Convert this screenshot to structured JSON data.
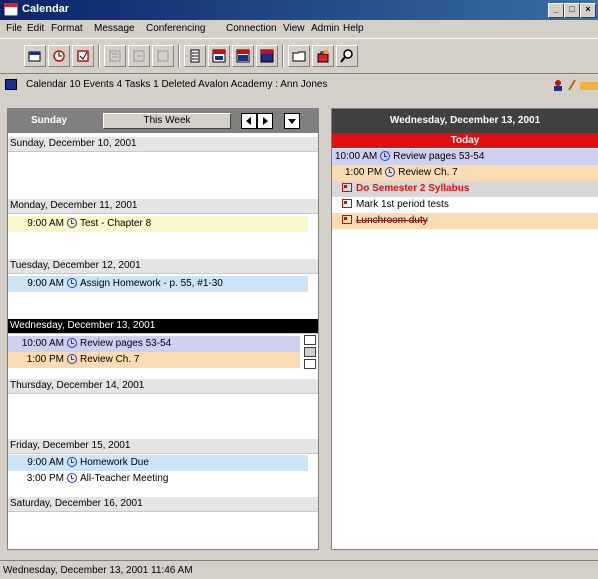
{
  "window": {
    "title": "Calendar"
  },
  "menu": [
    "File",
    "Edit",
    "Format",
    "Message",
    "Conferencing",
    "Connection",
    "View",
    "Admin",
    "Help"
  ],
  "toolbar": {
    "icons": [
      "new-window-icon",
      "open-icon",
      "open-alt-icon",
      "disabled-icon-1",
      "disabled-icon-2",
      "disabled-icon-3",
      "day-view-icon",
      "week-view-icon",
      "month-view-icon",
      "year-view-icon",
      "folder-icon",
      "bag-icon",
      "find-icon"
    ]
  },
  "status": {
    "text": "Calendar   10 Events  4 Tasks  1 Deleted   Avalon Academy : Ann Jones"
  },
  "week": {
    "day_label": "Sunday",
    "range_label": "This Week",
    "days": [
      {
        "header": "Sunday, December 10, 2001",
        "events": []
      },
      {
        "header": "Monday, December 11, 2001",
        "events": [
          {
            "time": "9:00 AM",
            "title": "Test - Chapter 8",
            "bg": "#fff7cc"
          }
        ]
      },
      {
        "header": "Tuesday, December 12, 2001",
        "events": [
          {
            "time": "9:00 AM",
            "title": "Assign Homework - p. 55, #1-30",
            "bg": "#cde4f7"
          }
        ]
      },
      {
        "header": "Wednesday, December 13, 2001",
        "today": true,
        "events": [
          {
            "time": "10:00 AM",
            "title": "Review pages 53-54",
            "bg": "#cfcff2"
          },
          {
            "time": "1:00 PM",
            "title": "Review Ch. 7",
            "bg": "#fbdcb2"
          }
        ]
      },
      {
        "header": "Thursday, December 14, 2001",
        "events": []
      },
      {
        "header": "Friday, December 15, 2001",
        "events": [
          {
            "time": "9:00 AM",
            "title": "Homework Due",
            "bg": "#cde4f7"
          },
          {
            "time": "3:00 PM",
            "title": "All-Teacher Meeting",
            "bg": "#ffffff"
          }
        ]
      },
      {
        "header": "Saturday, December 16, 2001",
        "events": []
      }
    ]
  },
  "day_view": {
    "title": "Wednesday, December 13, 2001",
    "today_label": "Today",
    "events": [
      {
        "time": "10:00 AM",
        "title": "Review pages 53-54",
        "bg": "#cfcff2"
      },
      {
        "time": "1:00 PM",
        "title": "Review Ch. 7",
        "bg": "#fbdcb2"
      }
    ],
    "tasks": [
      {
        "title": "Do Semester 2 Syllabus",
        "style": "priority"
      },
      {
        "title": "Mark 1st period tests",
        "style": "normal"
      },
      {
        "title": "Lunchroom duty",
        "style": "done"
      }
    ]
  },
  "statusbar": {
    "text": "Wednesday, December 13, 2001 11:46 AM"
  }
}
